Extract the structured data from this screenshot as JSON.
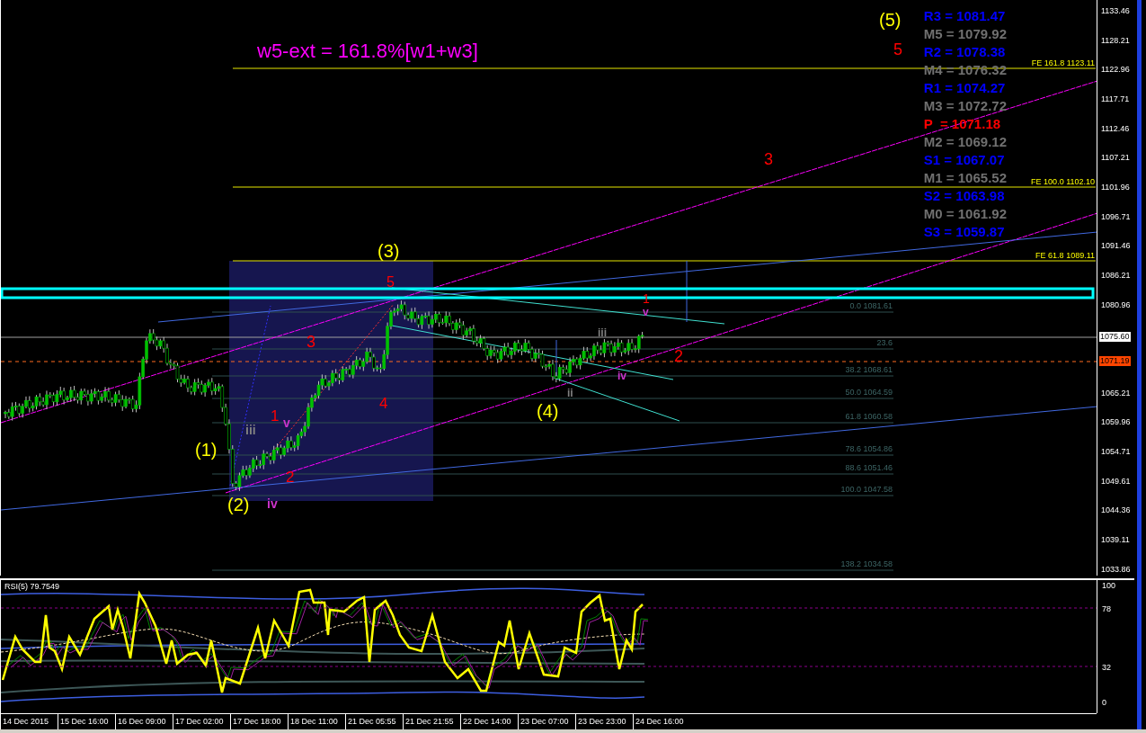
{
  "chart": {
    "annotation": "w5-ext = 161.8%[w1+w3]",
    "waves": [
      {
        "text": "(5)",
        "color": "#ffff00"
      },
      {
        "text": "5",
        "color": "#ff0000"
      },
      {
        "text": "3",
        "color": "#ff0000"
      },
      {
        "text": "(3)",
        "color": "#ffff00"
      },
      {
        "text": "5",
        "color": "#ff0000"
      },
      {
        "text": "3",
        "color": "#ff0000"
      },
      {
        "text": "1",
        "color": "#ff0000"
      },
      {
        "text": "4",
        "color": "#ff0000"
      },
      {
        "text": "(1)",
        "color": "#ffff00"
      },
      {
        "text": "(2)",
        "color": "#ffff00"
      },
      {
        "text": "2",
        "color": "#ff0000"
      },
      {
        "text": "iii",
        "color": "#808080"
      },
      {
        "text": "v",
        "color": "#cc33cc"
      },
      {
        "text": "iv",
        "color": "#cc33cc"
      },
      {
        "text": "(4)",
        "color": "#ffff00"
      },
      {
        "text": "ii",
        "color": "#808080"
      },
      {
        "text": "iii",
        "color": "#808080"
      },
      {
        "text": "1",
        "color": "#ff0000"
      },
      {
        "text": "v",
        "color": "#cc33cc"
      },
      {
        "text": "iv",
        "color": "#cc33cc"
      },
      {
        "text": "2",
        "color": "#ff0000"
      }
    ],
    "pivots": [
      {
        "text": "R3 = 1081.47",
        "color": "#0000ff"
      },
      {
        "text": "M5 = 1079.92",
        "color": "#707070"
      },
      {
        "text": "R2 = 1078.38",
        "color": "#0000ff"
      },
      {
        "text": "M4 = 1076.32",
        "color": "#707070"
      },
      {
        "text": "R1 = 1074.27",
        "color": "#0000ff"
      },
      {
        "text": "M3 = 1072.72",
        "color": "#707070"
      },
      {
        "text": "P  = 1071.18",
        "color": "#ff0000"
      },
      {
        "text": "M2 = 1069.12",
        "color": "#707070"
      },
      {
        "text": "S1 = 1067.07",
        "color": "#0000ff"
      },
      {
        "text": "M1 = 1065.52",
        "color": "#707070"
      },
      {
        "text": "S2 = 1063.98",
        "color": "#0000ff"
      },
      {
        "text": "M0 = 1061.92",
        "color": "#707070"
      },
      {
        "text": "S3 = 1059.87",
        "color": "#0000ff"
      }
    ],
    "expansions": [
      "FE 161.8 1123.11",
      "FE 100.0 1102.10",
      "FE 61.8 1089.11"
    ],
    "retracements": [
      "0.0 1081.61",
      "23.6",
      "38.2 1068.61",
      "50.0 1064.59",
      "61.8 1060.58",
      "78.6 1054.86",
      "88.6 1051.46",
      "100.0 1047.58",
      "138.2 1034.58"
    ],
    "price_axis": [
      "1133.46",
      "1128.21",
      "1122.96",
      "1117.71",
      "1112.46",
      "1107.21",
      "1101.96",
      "1096.71",
      "1091.46",
      "1086.21",
      "1080.96",
      "1065.21",
      "1059.96",
      "1054.71",
      "1049.61",
      "1044.36",
      "1039.11",
      "1033.86"
    ],
    "current_price": "1075.60",
    "pivot_price": "1071.19"
  },
  "rsi": {
    "label": "RSI(5) 79.7549",
    "axis": [
      "100",
      "78",
      "32",
      "0"
    ]
  },
  "time_axis": [
    "14 Dec 2015",
    "15 Dec 16:00",
    "16 Dec 09:00",
    "17 Dec 02:00",
    "17 Dec 18:00",
    "18 Dec 11:00",
    "21 Dec 05:55",
    "21 Dec 21:55",
    "22 Dec 14:00",
    "23 Dec 07:00",
    "23 Dec 23:00",
    "24 Dec 16:00"
  ]
}
